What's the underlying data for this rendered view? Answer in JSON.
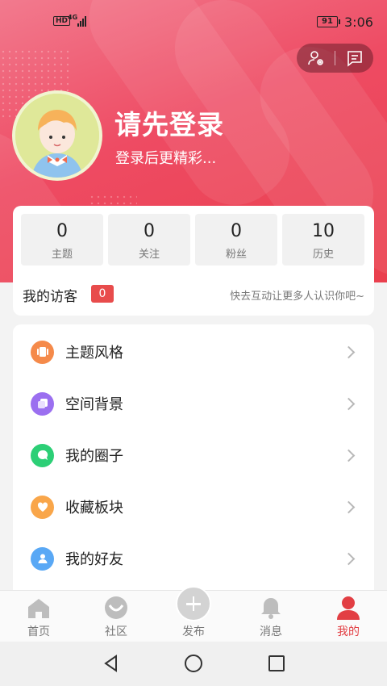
{
  "status_bar": {
    "hd": "HD",
    "network": "4G",
    "battery": "91",
    "time": "3:06"
  },
  "header": {
    "settings_icon": "user-settings-icon",
    "message_icon": "message-icon",
    "login_title": "请先登录",
    "login_subtitle": "登录后更精彩..."
  },
  "stats": [
    {
      "value": "0",
      "label": "主题"
    },
    {
      "value": "0",
      "label": "关注"
    },
    {
      "value": "0",
      "label": "粉丝"
    },
    {
      "value": "10",
      "label": "历史"
    }
  ],
  "visitors": {
    "label": "我的访客",
    "count": "0",
    "hint": "快去互动让更多人认识你吧~"
  },
  "menu": [
    {
      "label": "主题风格",
      "icon": "theme-icon",
      "color": "#f58a4a"
    },
    {
      "label": "空间背景",
      "icon": "background-icon",
      "color": "#9b6ff0"
    },
    {
      "label": "我的圈子",
      "icon": "chat-circle-icon",
      "color": "#2ccf76"
    },
    {
      "label": "收藏板块",
      "icon": "heart-icon",
      "color": "#f9a64a"
    },
    {
      "label": "我的好友",
      "icon": "friend-icon",
      "color": "#59a8f5"
    }
  ],
  "tabs": [
    {
      "label": "首页",
      "icon": "home-icon"
    },
    {
      "label": "社区",
      "icon": "community-icon"
    },
    {
      "label": "发布",
      "icon": "plus-icon"
    },
    {
      "label": "消息",
      "icon": "bell-icon"
    },
    {
      "label": "我的",
      "icon": "profile-icon",
      "active": true
    }
  ],
  "colors": {
    "accent": "#e23e43",
    "header_start": "#f27a8e",
    "header_end": "#ea3f4d"
  }
}
